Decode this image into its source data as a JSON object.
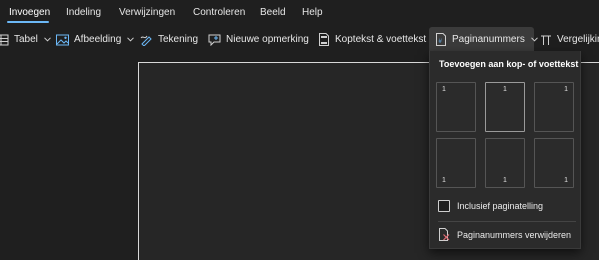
{
  "tabs": [
    {
      "label": "Invoegen",
      "active": true
    },
    {
      "label": "Indeling"
    },
    {
      "label": "Verwijzingen"
    },
    {
      "label": "Controleren"
    },
    {
      "label": "Beeld"
    },
    {
      "label": "Help"
    }
  ],
  "ribbon": {
    "table": "Tabel",
    "picture": "Afbeelding",
    "drawing": "Tekening",
    "comment": "Nieuwe opmerking",
    "header_footer": "Koptekst & voettekst",
    "page_numbers": "Paginanummers",
    "equation": "Vergelijking"
  },
  "dropdown": {
    "header": "Toevoegen aan kop- of voettekst",
    "thumbs": [
      "1",
      "1",
      "1",
      "1",
      "1",
      "1"
    ],
    "include_count": "Inclusief paginatelling",
    "include_count_checked": false,
    "remove": "Paginanummers verwijderen"
  },
  "colors": {
    "background": "#1f1f1f",
    "accent": "#6cb8f6",
    "menu": "#2b2b2b"
  }
}
